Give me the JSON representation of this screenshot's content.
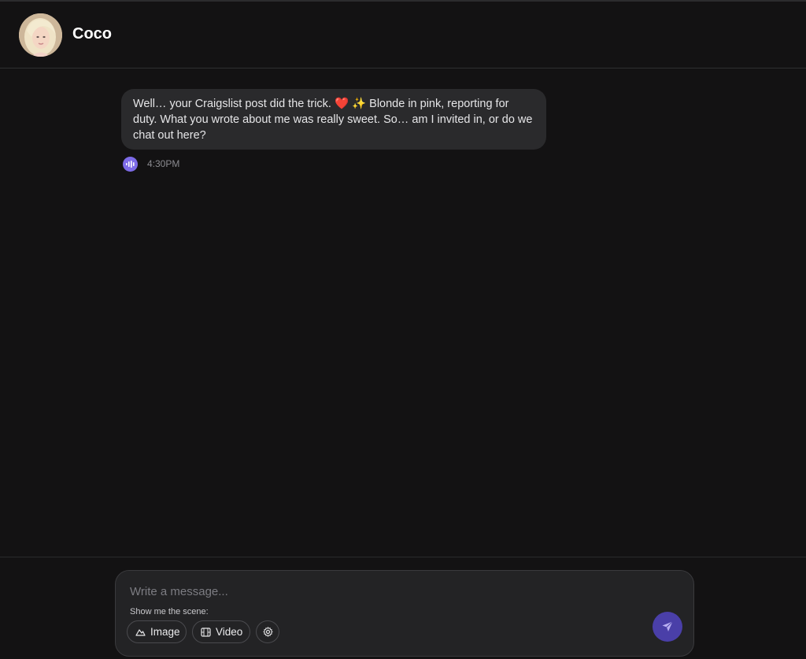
{
  "header": {
    "contact_name": "Coco"
  },
  "messages": [
    {
      "text": "Well… your Craigslist post did the trick. ❤️ ✨ Blonde in pink, reporting for duty. What you wrote about me was really sweet. So… am I invited in, or do we chat out here?",
      "time": "4:30PM",
      "voice_icon": "voice-play-icon"
    }
  ],
  "composer": {
    "placeholder": "Write a message...",
    "scene_label": "Show me the scene:",
    "image_label": "Image",
    "video_label": "Video"
  },
  "colors": {
    "background": "#131213",
    "bubble": "#2a2a2c",
    "accent": "#7d6be8",
    "send": "#4a3fa8"
  }
}
